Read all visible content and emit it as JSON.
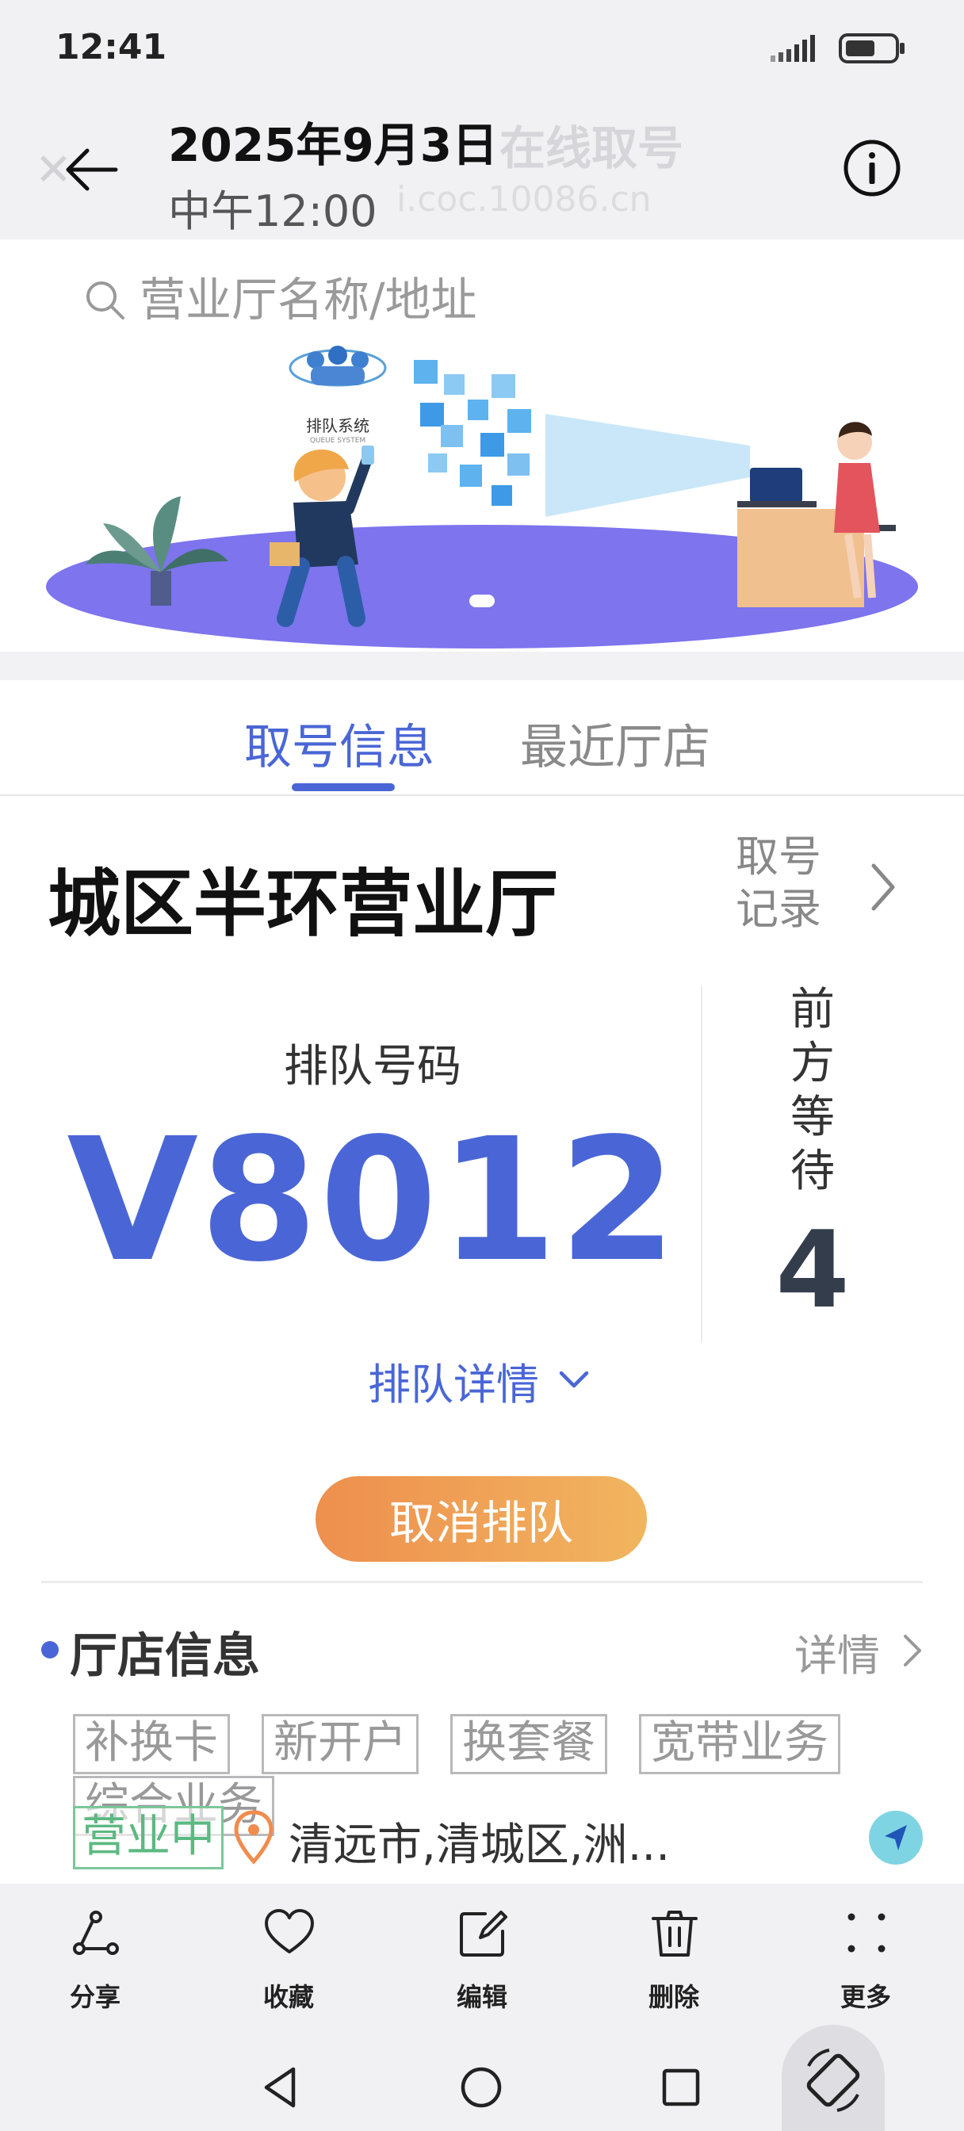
{
  "status_bar": {
    "time": "12:41"
  },
  "header": {
    "date": "2025年9月3日",
    "time": "中午12:00",
    "ghost_title": "在线取号",
    "ghost_url": "i.coc.10086.cn"
  },
  "search": {
    "placeholder": "营业厅名称/地址"
  },
  "banner": {
    "logo_text": "排队系统",
    "logo_sub": "QUEUE SYSTEM"
  },
  "tabs": [
    {
      "label": "取号信息"
    },
    {
      "label": "最近厅店"
    }
  ],
  "store": {
    "name": "城区半环营业厅",
    "record_link": "取号记录"
  },
  "queue": {
    "number_label": "排队号码",
    "number": "V8012",
    "waiting_label": "前方等待",
    "waiting_count": "4",
    "detail_label": "排队详情"
  },
  "cancel_button": "取消排队",
  "store_info": {
    "title": "厅店信息",
    "details_label": "详情",
    "tags": [
      "补换卡",
      "新开户",
      "换套餐",
      "宽带业务",
      "综合业务"
    ],
    "status": "营业中",
    "address": "清远市,清城区,洲..."
  },
  "toolbar": [
    {
      "label": "分享",
      "icon": "share-icon"
    },
    {
      "label": "收藏",
      "icon": "heart-icon"
    },
    {
      "label": "编辑",
      "icon": "edit-icon"
    },
    {
      "label": "删除",
      "icon": "trash-icon"
    },
    {
      "label": "更多",
      "icon": "more-icon"
    }
  ],
  "colors": {
    "accent": "#4a66d6",
    "cancel_start": "#ee8f4e",
    "cancel_end": "#f1b55f",
    "open_status": "#5cb981"
  }
}
